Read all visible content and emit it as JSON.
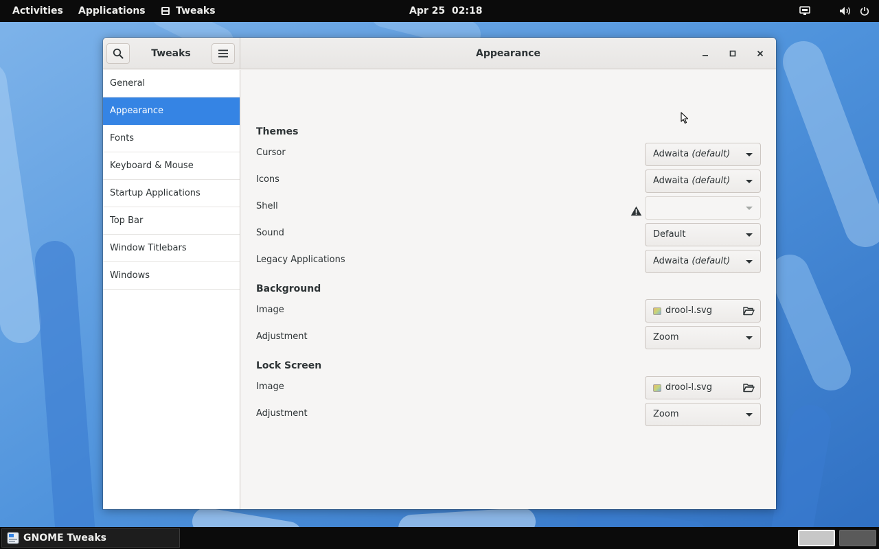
{
  "topbar": {
    "activities": "Activities",
    "applications": "Applications",
    "app_name": "Tweaks",
    "clock": "Apr 25  02:18"
  },
  "window": {
    "headerbar": {
      "app_title": "Tweaks",
      "page_title": "Appearance"
    },
    "sidebar": {
      "items": [
        {
          "label": "General",
          "selected": false
        },
        {
          "label": "Appearance",
          "selected": true
        },
        {
          "label": "Fonts",
          "selected": false
        },
        {
          "label": "Keyboard & Mouse",
          "selected": false
        },
        {
          "label": "Startup Applications",
          "selected": false
        },
        {
          "label": "Top Bar",
          "selected": false
        },
        {
          "label": "Window Titlebars",
          "selected": false
        },
        {
          "label": "Windows",
          "selected": false
        }
      ]
    },
    "content": {
      "themes": {
        "title": "Themes",
        "cursor": {
          "label": "Cursor",
          "value": "Adwaita",
          "value_suffix": "(default)"
        },
        "icons": {
          "label": "Icons",
          "value": "Adwaita",
          "value_suffix": "(default)"
        },
        "shell": {
          "label": "Shell",
          "value": "",
          "disabled": true,
          "warning": true
        },
        "sound": {
          "label": "Sound",
          "value": "Default"
        },
        "legacy": {
          "label": "Legacy Applications",
          "value": "Adwaita",
          "value_suffix": "(default)"
        }
      },
      "background": {
        "title": "Background",
        "image": {
          "label": "Image",
          "file": "drool-l.svg"
        },
        "adjustment": {
          "label": "Adjustment",
          "value": "Zoom"
        }
      },
      "lock_screen": {
        "title": "Lock Screen",
        "image": {
          "label": "Image",
          "file": "drool-l.svg"
        },
        "adjustment": {
          "label": "Adjustment",
          "value": "Zoom"
        }
      }
    }
  },
  "taskbar": {
    "task_label": "GNOME Tweaks",
    "workspaces": [
      "workspace-1",
      "workspace-2"
    ],
    "active_workspace": 1
  },
  "colors": {
    "accent": "#3584e4",
    "panel": "#0b0b0b",
    "window_bg": "#f6f5f4",
    "wallpaper": "#4a8fd8"
  }
}
